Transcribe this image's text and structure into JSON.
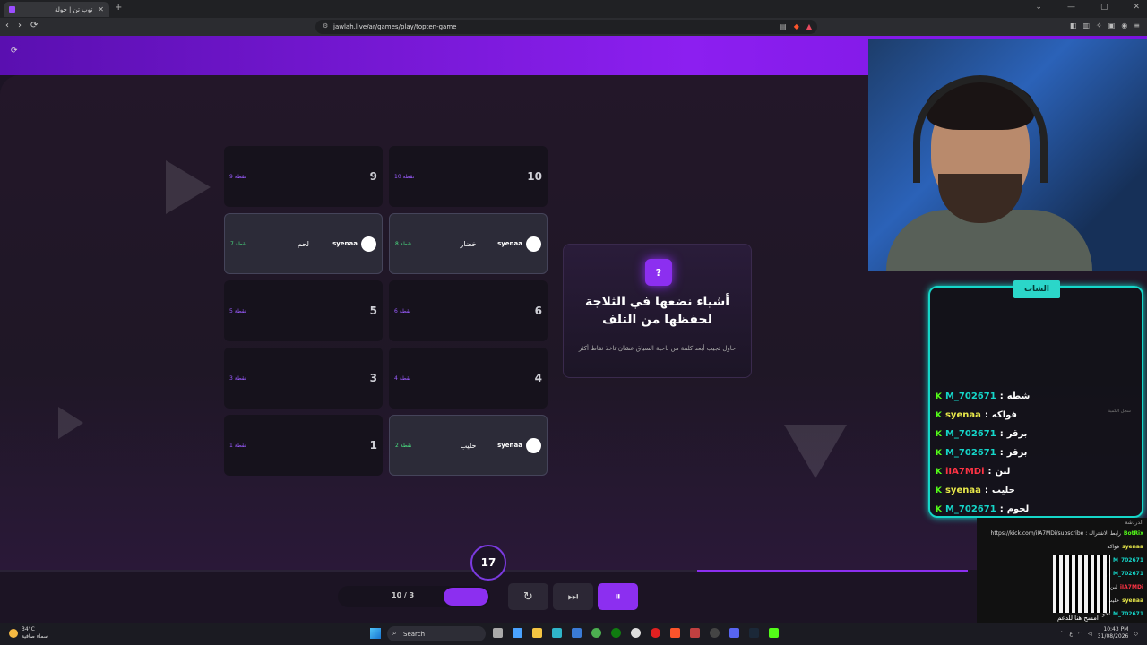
{
  "browser": {
    "tab_title": "توب تن | جولة",
    "tab_close": "✕",
    "new_tab": "+",
    "url": "jawlah.live/ar/games/play/topten-game",
    "win_min": "⌄",
    "win_sep": "—",
    "win_max": "▢",
    "win_close": "✕",
    "back": "‹",
    "forward": "›",
    "reload": "⟳"
  },
  "game": {
    "cards": [
      {
        "num": "10",
        "pts": "10 نقطة",
        "answer": "",
        "player": ""
      },
      {
        "num": "9",
        "pts": "9 نقطة",
        "answer": "",
        "player": ""
      },
      {
        "num": "",
        "pts": "8 نقطة",
        "answer": "خضار",
        "player": "syenaa"
      },
      {
        "num": "",
        "pts": "7 نقطة",
        "answer": "لحم",
        "player": "syenaa"
      },
      {
        "num": "6",
        "pts": "6 نقطة",
        "answer": "",
        "player": ""
      },
      {
        "num": "5",
        "pts": "5 نقطة",
        "answer": "",
        "player": ""
      },
      {
        "num": "4",
        "pts": "4 نقطة",
        "answer": "",
        "player": ""
      },
      {
        "num": "3",
        "pts": "3 نقطة",
        "answer": "",
        "player": ""
      },
      {
        "num": "",
        "pts": "2 نقطة",
        "answer": "حليب",
        "player": "syenaa"
      },
      {
        "num": "1",
        "pts": "1 نقطة",
        "answer": "",
        "player": ""
      }
    ],
    "question_badge": "?",
    "question_title": "أشياء نضعها في الثلاجة لحفظها من التلف",
    "question_hint": "حاول تجيب أبعد كلمة من ناحية السياق عشان تاخذ نقاط أكثر",
    "timer": "17",
    "round_count": "10 / 3",
    "progress": 0.28
  },
  "chat": {
    "tag": "الشات",
    "messages": [
      {
        "user": "M_702671",
        "text": "شطه",
        "color": "teal"
      },
      {
        "user": "syenaa",
        "text": "فواكه",
        "color": "yellow"
      },
      {
        "user": "M_702671",
        "text": "برقر",
        "color": "teal"
      },
      {
        "user": "M_702671",
        "text": "برقر",
        "color": "teal"
      },
      {
        "user": "iIA7MDi",
        "text": "لبن",
        "color": "red"
      },
      {
        "user": "syenaa",
        "text": "حليب",
        "color": "yellow"
      },
      {
        "user": "M_702671",
        "text": "لحوم",
        "color": "teal"
      }
    ],
    "side_hint": "سجل الكمية"
  },
  "kick_chat": {
    "header": "الدردشة",
    "lines": [
      {
        "user": "BotRix",
        "text": "رابط الاشتراك : https://kick.com/iIA7MDi/subscribe"
      },
      {
        "user": "syenaa",
        "text": "فواكه"
      },
      {
        "user": "M_702671",
        "text": "بر"
      },
      {
        "user": "M_702671",
        "text": "بر"
      },
      {
        "user": "iIA7MDi",
        "text": "لبن"
      },
      {
        "user": "syenaa",
        "text": "حليب"
      },
      {
        "user": "M_702671",
        "text": "لحو"
      }
    ],
    "qr_label": "امسح هنا للدعم"
  },
  "taskbar": {
    "temp": "34°C",
    "weather": "سماء صافية",
    "search": "Search",
    "time": "10:43 PM",
    "date": "31/08/2026",
    "lang": "ع"
  }
}
